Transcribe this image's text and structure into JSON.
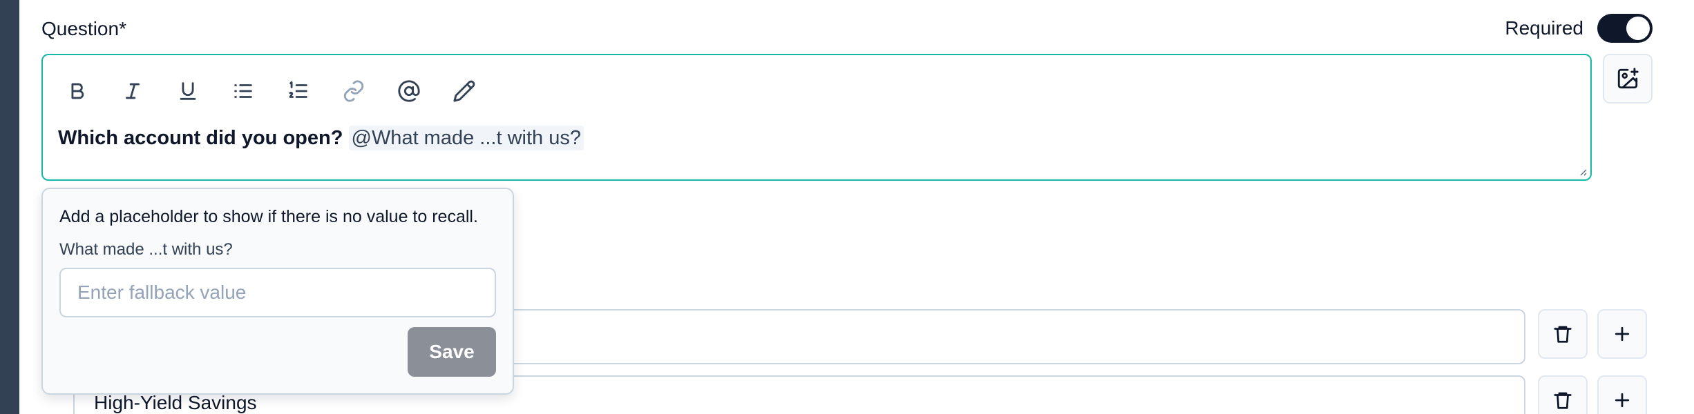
{
  "question": {
    "label": "Question*",
    "required_label": "Required",
    "required_on": true,
    "bold_text": "Which account did you open?",
    "recall_mention": "@What made ...t with us?"
  },
  "toolbar": {
    "buttons": [
      "bold-icon",
      "italic-icon",
      "underline-icon",
      "bullet-list-icon",
      "numbered-list-icon",
      "link-icon",
      "mention-icon",
      "pencil-icon"
    ]
  },
  "fallback_popover": {
    "help_text": "Add a placeholder to show if there is no value to recall.",
    "field_label": "What made ...t with us?",
    "input_value": "",
    "input_placeholder": "Enter fallback value",
    "save_label": "Save"
  },
  "choices": [
    {
      "value": ""
    },
    {
      "value": "High-Yield Savings"
    }
  ],
  "colors": {
    "accent": "#14b8a6",
    "toggle": "#0f172a",
    "save_disabled": "#8a8f98"
  }
}
